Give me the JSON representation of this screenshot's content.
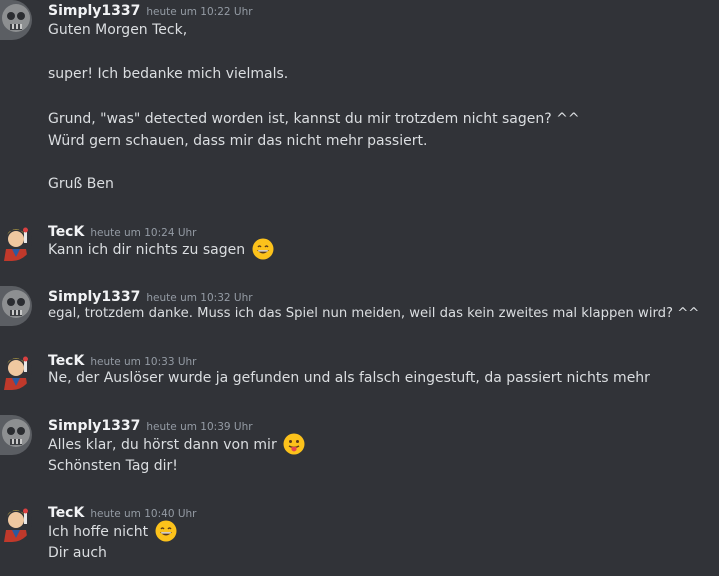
{
  "messages": [
    {
      "username": "Simply1337",
      "timestamp": "heute um 10:22 Uhr",
      "lines": [
        "Guten Morgen Teck,",
        "super! Ich bedanke mich vielmals.",
        "Grund, \"was\" detected worden ist, kannst du mir trotzdem nicht sagen? ^^",
        "Würd gern schauen, dass mir das nicht mehr passiert.",
        "Gruß Ben"
      ]
    },
    {
      "username": "TecK",
      "timestamp": "heute um 10:24 Uhr",
      "lines": [
        "Kann ich dir nichts zu sagen"
      ],
      "emoji": "grinning-face-icon"
    },
    {
      "username": "Simply1337",
      "timestamp": "heute um 10:32 Uhr",
      "lines": [
        "egal, trotzdem danke. Muss ich das Spiel nun meiden, weil das kein zweites mal klappen wird? ^^"
      ]
    },
    {
      "username": "TecK",
      "timestamp": "heute um 10:33 Uhr",
      "lines": [
        "Ne, der Auslöser wurde ja gefunden und als falsch eingestuft, da passiert nichts mehr"
      ]
    },
    {
      "username": "Simply1337",
      "timestamp": "heute um 10:39 Uhr",
      "lines": [
        "Alles klar, du hörst dann von mir",
        "Schönsten Tag dir!"
      ],
      "emoji": "tongue-face-icon"
    },
    {
      "username": "TecK",
      "timestamp": "heute um 10:40 Uhr",
      "lines": [
        "Ich hoffe nicht",
        "Dir auch"
      ],
      "emoji": "grinning-face-icon"
    }
  ],
  "colors": {
    "background": "#313338",
    "username": "#f2f3f5",
    "text": "#dbdee1",
    "timestamp": "#949ba4"
  }
}
